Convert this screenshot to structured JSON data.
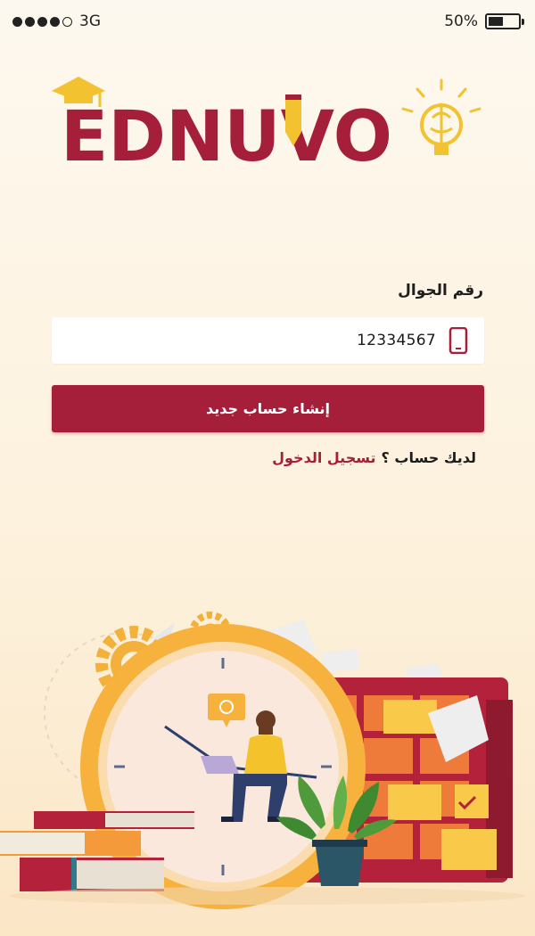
{
  "status_bar": {
    "carrier": "3G",
    "battery_percent": "50%",
    "battery_level": 0.5,
    "signal_bars_filled": 4,
    "signal_bars_total": 5
  },
  "logo": {
    "text": "EDNUVO",
    "brand_color": "#a61f3a",
    "accent_color": "#f2c230"
  },
  "form": {
    "phone_label": "رقم الجوال",
    "phone_value": "12334567",
    "phone_icon": "mobile-phone-icon",
    "signup_label": "إنشاء حساب جديد"
  },
  "login": {
    "question": "لديك حساب ؟",
    "link_label": "تسجيل الدخول"
  },
  "illustration": {
    "name": "student-with-laptop-on-clock-illustration"
  }
}
